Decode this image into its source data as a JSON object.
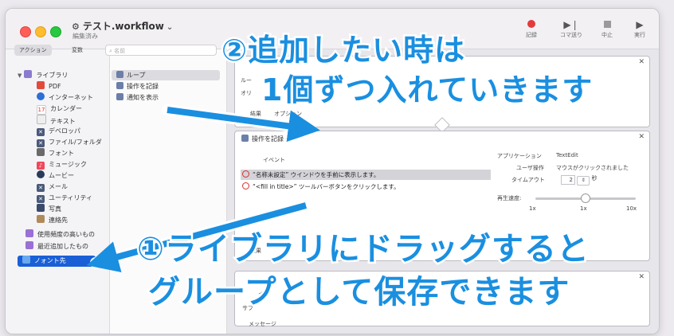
{
  "window": {
    "title": "テスト.workflow",
    "subtitle": "編集済み"
  },
  "toolbar": {
    "record_label": "記録",
    "step_label": "コマ送り",
    "stop_label": "中止",
    "run_label": "実行"
  },
  "library": {
    "tab_actions": "アクション",
    "tab_variables": "変数",
    "search_placeholder": "名前",
    "root_label": "ライブラリ",
    "items": [
      {
        "label": "PDF"
      },
      {
        "label": "インターネット"
      },
      {
        "label": "カレンダー"
      },
      {
        "label": "テキスト"
      },
      {
        "label": "デベロッパ"
      },
      {
        "label": "ファイル/フォルダ"
      },
      {
        "label": "フォント"
      },
      {
        "label": "ミュージック"
      },
      {
        "label": "ムービー"
      },
      {
        "label": "メール"
      },
      {
        "label": "ユーティリティ"
      },
      {
        "label": "写真"
      },
      {
        "label": "連絡先"
      }
    ],
    "smart": [
      {
        "label": "使用頻度の高いもの"
      },
      {
        "label": "最近追加したもの"
      }
    ],
    "selected_folder": "ノォント先"
  },
  "actions": [
    {
      "label": "ループ"
    },
    {
      "label": "操作を記録"
    },
    {
      "label": "通知を表示"
    }
  ],
  "workflow": {
    "block1": {
      "partial_a": "ルー",
      "partial_b": "オリ",
      "tab_result": "結果",
      "tab_option": "オプション"
    },
    "block2": {
      "title": "操作を記録",
      "event_header": "イベント",
      "events": [
        "“名称未設定” ウインドウを手前に表示します。",
        "“<fill in title>” ツールバーボタンをクリックします。"
      ],
      "app_label": "アプリケーション",
      "app_value": "TextEdit",
      "user_action_label": "ユーザ操作",
      "user_action_value": "マウスがクリックされました",
      "timeout_label": "タイムアウト",
      "timeout_value": "2",
      "timeout_unit": "秒",
      "speed_label": "再生速度:",
      "speed_ticks": [
        "1x",
        "1x",
        "10x"
      ],
      "tab_result": "結果"
    },
    "block3": {
      "row_a": "イ",
      "row_b": "サブ",
      "message_label": "メッセージ"
    }
  },
  "annotations": {
    "line1": "②追加したい時は",
    "line2": "1個ずつ入れていきます",
    "line3": "①ライブラリにドラッグすると",
    "line4": "グループとして保存できます"
  },
  "colors": {
    "annotation": "#1a8fe0",
    "selection": "#1a5fd6"
  }
}
